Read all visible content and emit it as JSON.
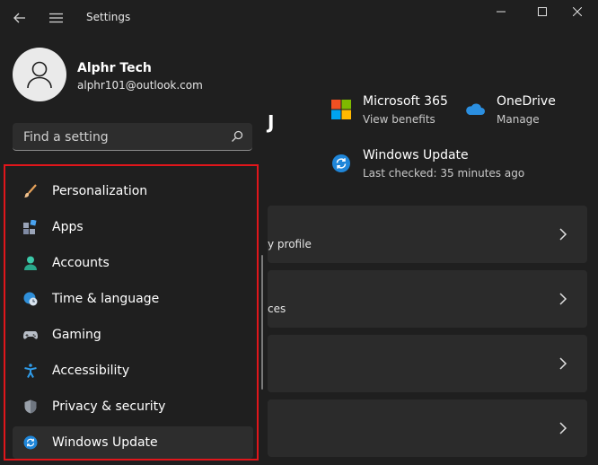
{
  "titlebar": {
    "title": "Settings",
    "back_icon": "arrow-left-icon",
    "menu_icon": "hamburger-menu-icon",
    "controls": [
      "minimize-icon",
      "maximize-icon",
      "close-icon"
    ]
  },
  "profile": {
    "name": "Alphr Tech",
    "email": "alphr101@outlook.com"
  },
  "search": {
    "placeholder": "Find a setting"
  },
  "nav": {
    "items": [
      {
        "label": "Personalization",
        "icon": "paintbrush-icon"
      },
      {
        "label": "Apps",
        "icon": "apps-icon"
      },
      {
        "label": "Accounts",
        "icon": "person-icon"
      },
      {
        "label": "Time & language",
        "icon": "globe-clock-icon"
      },
      {
        "label": "Gaming",
        "icon": "gamepad-icon"
      },
      {
        "label": "Accessibility",
        "icon": "accessibility-icon"
      },
      {
        "label": "Privacy & security",
        "icon": "shield-icon"
      },
      {
        "label": "Windows Update",
        "icon": "windows-update-icon"
      }
    ],
    "active_index": 7,
    "highlight_color": "#e0161b"
  },
  "main": {
    "partial_heading": "J",
    "services": [
      {
        "title": "Microsoft 365",
        "subtitle": "View benefits",
        "icon": "microsoft-logo-icon"
      },
      {
        "title": "OneDrive",
        "subtitle": "Manage",
        "icon": "onedrive-cloud-icon"
      },
      {
        "title": "Windows Update",
        "subtitle": "Last checked: 35 minutes ago",
        "icon": "windows-update-icon"
      }
    ],
    "cards": [
      {
        "text": "y profile"
      },
      {
        "text": "ces"
      },
      {
        "text": ""
      },
      {
        "text": ""
      }
    ]
  },
  "colors": {
    "background": "#1f1f1f",
    "accent_blue": "#0f7dd4",
    "accounts_teal": "#2eb89a"
  }
}
